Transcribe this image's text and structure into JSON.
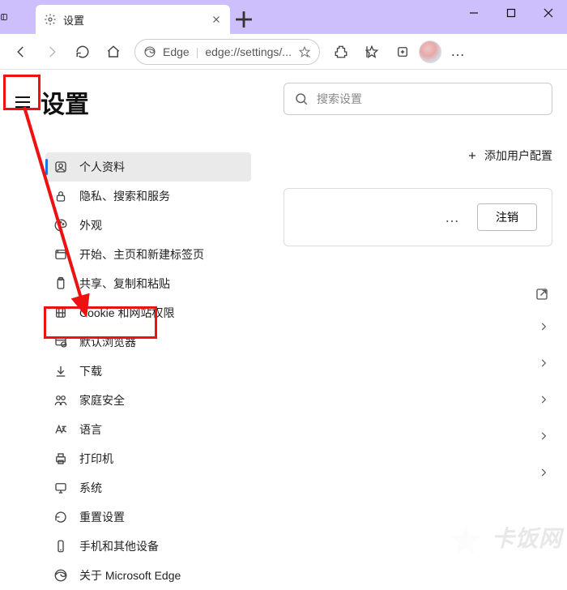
{
  "window": {
    "minimize": "—",
    "maximize": "☐",
    "close": "✕"
  },
  "tab": {
    "title": "设置",
    "newtab": "＋"
  },
  "toolbar": {
    "edge_label": "Edge",
    "url": "edge://settings/...",
    "more": "…"
  },
  "settings": {
    "title": "设置"
  },
  "nav": [
    {
      "key": "profile",
      "label": "个人资料"
    },
    {
      "key": "privacy",
      "label": "隐私、搜索和服务"
    },
    {
      "key": "appearance",
      "label": "外观"
    },
    {
      "key": "start",
      "label": "开始、主页和新建标签页"
    },
    {
      "key": "share",
      "label": "共享、复制和粘贴"
    },
    {
      "key": "cookies",
      "label": "Cookie 和网站权限"
    },
    {
      "key": "default",
      "label": "默认浏览器"
    },
    {
      "key": "downloads",
      "label": "下载"
    },
    {
      "key": "family",
      "label": "家庭安全"
    },
    {
      "key": "language",
      "label": "语言"
    },
    {
      "key": "printer",
      "label": "打印机"
    },
    {
      "key": "system",
      "label": "系统"
    },
    {
      "key": "reset",
      "label": "重置设置"
    },
    {
      "key": "phone",
      "label": "手机和其他设备"
    },
    {
      "key": "about",
      "label": "关于 Microsoft Edge"
    }
  ],
  "content": {
    "search_placeholder": "搜索设置",
    "add_profile": "添加用户配置",
    "more": "…",
    "logout": "注销"
  },
  "watermark": "卡饭网"
}
